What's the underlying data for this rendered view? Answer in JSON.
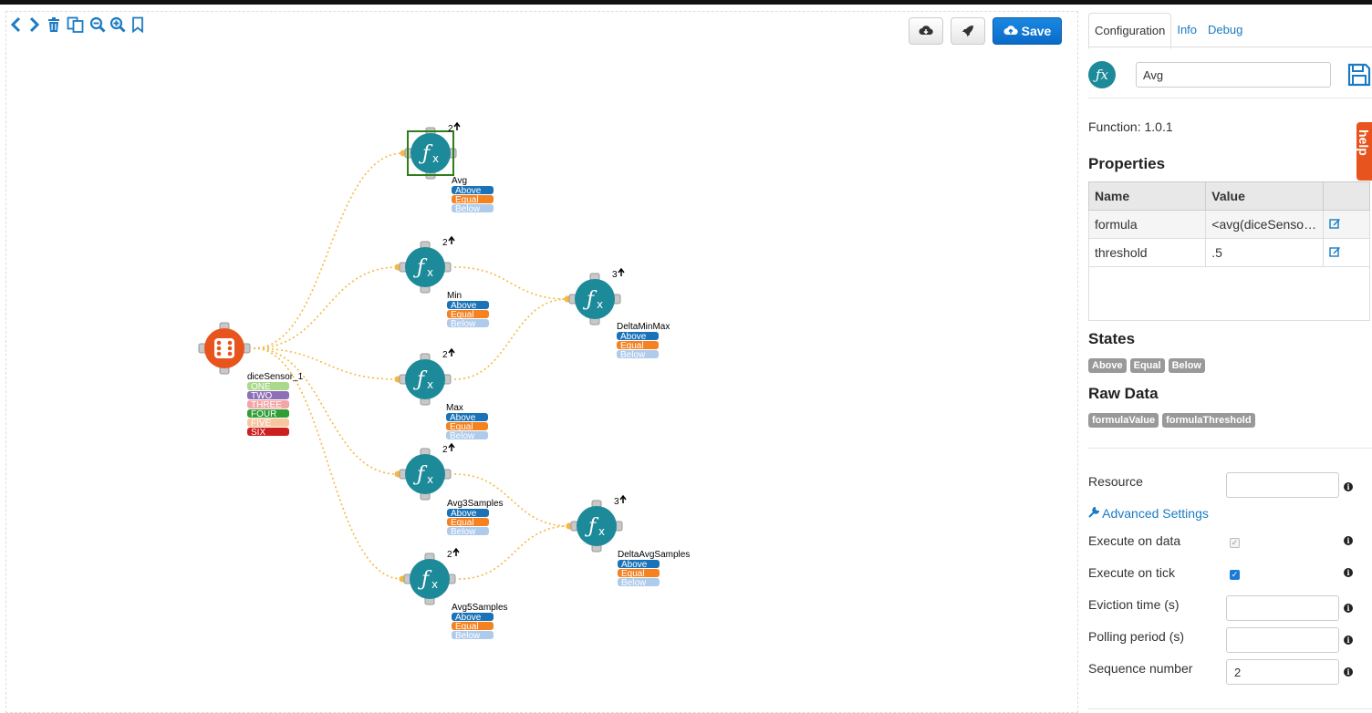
{
  "toolbar": {
    "icons": [
      "code-icon",
      "trash-icon",
      "copy-icon",
      "zoom-out-icon",
      "zoom-in-icon",
      "bookmark-icon"
    ],
    "save_label": "Save"
  },
  "colors": {
    "accent": "#1a7bc4",
    "node": "#1d8a99",
    "sensor": "#e8541e",
    "above": "#1a73b8",
    "equal": "#f58220",
    "below": "#aecbeb",
    "link": "#f5b942"
  },
  "graph": {
    "sensor": {
      "label": "diceSensor_1",
      "tags": [
        {
          "text": "ONE",
          "color": "#a9d98a"
        },
        {
          "text": "TWO",
          "color": "#8e6fb5"
        },
        {
          "text": "THREE",
          "color": "#f4a6a6"
        },
        {
          "text": "FOUR",
          "color": "#2e9e35"
        },
        {
          "text": "FIVE",
          "color": "#f7c59f"
        },
        {
          "text": "SIX",
          "color": "#cc1f1f"
        }
      ]
    },
    "functions": [
      {
        "id": "avg",
        "label": "Avg",
        "count": "2",
        "selected": true
      },
      {
        "id": "min",
        "label": "Min",
        "count": "2"
      },
      {
        "id": "max",
        "label": "Max",
        "count": "2"
      },
      {
        "id": "avg3",
        "label": "Avg3Samples",
        "count": "2"
      },
      {
        "id": "avg5",
        "label": "Avg5Samples",
        "count": "2"
      },
      {
        "id": "dmm",
        "label": "DeltaMinMax",
        "count": "3"
      },
      {
        "id": "das",
        "label": "DeltaAvgSamples",
        "count": "3"
      }
    ],
    "state_tags": [
      "Above",
      "Equal",
      "Below"
    ],
    "links": [
      [
        "sensor",
        "avg"
      ],
      [
        "sensor",
        "min"
      ],
      [
        "sensor",
        "max"
      ],
      [
        "sensor",
        "avg3"
      ],
      [
        "sensor",
        "avg5"
      ],
      [
        "min",
        "dmm"
      ],
      [
        "max",
        "dmm"
      ],
      [
        "avg3",
        "das"
      ],
      [
        "avg5",
        "das"
      ]
    ]
  },
  "panel": {
    "tabs": [
      "Configuration",
      "Info",
      "Debug"
    ],
    "active_tab": "Configuration",
    "node_name": "Avg",
    "function_version": "Function: 1.0.1",
    "help_label": "help",
    "properties_title": "Properties",
    "properties_headers": [
      "Name",
      "Value"
    ],
    "properties": [
      {
        "name": "formula",
        "value": "<avg(diceSensor..."
      },
      {
        "name": "threshold",
        "value": ".5"
      }
    ],
    "states_title": "States",
    "states": [
      "Above",
      "Equal",
      "Below"
    ],
    "raw_data_title": "Raw Data",
    "raw_data": [
      "formulaValue",
      "formulaThreshold"
    ],
    "resource_label": "Resource",
    "resource_value": "",
    "advanced_label": "Advanced Settings",
    "execute_on_data_label": "Execute on data",
    "execute_on_data": true,
    "execute_on_tick_label": "Execute on tick",
    "execute_on_tick": true,
    "eviction_label": "Eviction time (s)",
    "eviction_value": "",
    "polling_label": "Polling period (s)",
    "polling_value": "",
    "sequence_label": "Sequence number",
    "sequence_value": "2"
  }
}
